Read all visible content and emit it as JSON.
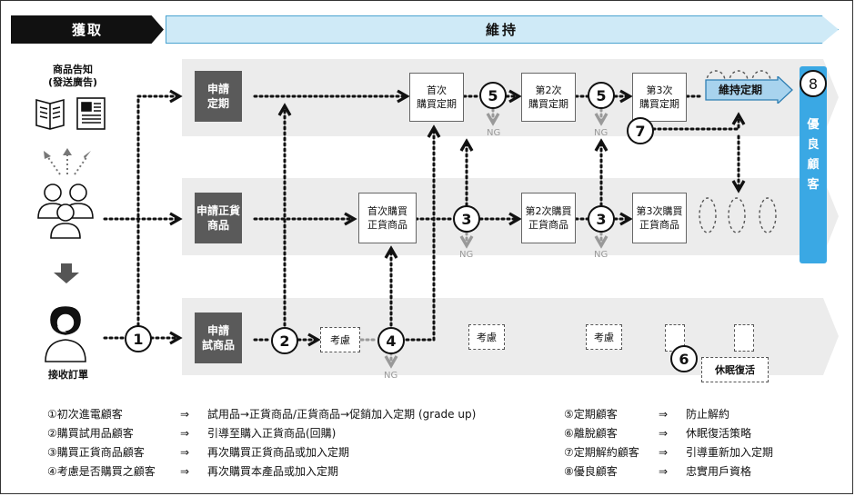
{
  "phases": {
    "acquisition": "獲取",
    "retention": "維持"
  },
  "left": {
    "ad_label_line1": "商品告知",
    "ad_label_line2": "(發送廣告)",
    "order_label": "接收訂單"
  },
  "lanes": {
    "subscription": {
      "label_line1": "申請",
      "label_line2": "定期"
    },
    "regular": {
      "label_line1": "申請正貨",
      "label_line2": "商品"
    },
    "trial": {
      "label_line1": "申請",
      "label_line2": "試商品"
    }
  },
  "boxes": {
    "sub1": {
      "line1": "首次",
      "line2": "購買定期"
    },
    "sub2": {
      "line1": "第2次",
      "line2": "購買定期"
    },
    "sub3": {
      "line1": "第3次",
      "line2": "購買定期"
    },
    "reg1": {
      "line1": "首次購買",
      "line2": "正貨商品"
    },
    "reg2": {
      "line1": "第2次購買",
      "line2": "正貨商品"
    },
    "reg3": {
      "line1": "第3次購買",
      "line2": "正貨商品"
    },
    "consider1": "考慮",
    "consider2": "考慮",
    "consider3": "考慮",
    "maintain": "維持定期",
    "revive": "休眠復活"
  },
  "circles": {
    "c1": "1",
    "c2": "2",
    "c3": "3",
    "c4": "4",
    "c5": "5",
    "c6": "6",
    "c7": "7",
    "c8": "8"
  },
  "ng": "NG",
  "loyal": {
    "line1": "優",
    "line2": "良",
    "line3": "顧",
    "line4": "客"
  },
  "arrow": "⇒",
  "legend_left": [
    {
      "label": "①初次進電顧客",
      "desc": "試用品→正貨商品/正貨商品→促銷加入定期 (grade up)"
    },
    {
      "label": "②購買試用品顧客",
      "desc": "引導至購入正貨商品(回購)"
    },
    {
      "label": "③購買正貨商品顧客",
      "desc": "再次購買正貨商品或加入定期"
    },
    {
      "label": "④考慮是否購買之顧客",
      "desc": "再次購買本產品或加入定期"
    }
  ],
  "legend_right": [
    {
      "label": "⑤定期顧客",
      "desc": "防止解約"
    },
    {
      "label": "⑥離脫顧客",
      "desc": "休眠復活策略"
    },
    {
      "label": "⑦定期解約顧客",
      "desc": "引導重新加入定期"
    },
    {
      "label": "⑧優良顧客",
      "desc": "忠實用戶資格"
    }
  ],
  "colors": {
    "accent": "#3aa8e4",
    "retention_band": "#cfeaf7",
    "dark_box": "#5a5a5a",
    "lane": "#ececec"
  }
}
